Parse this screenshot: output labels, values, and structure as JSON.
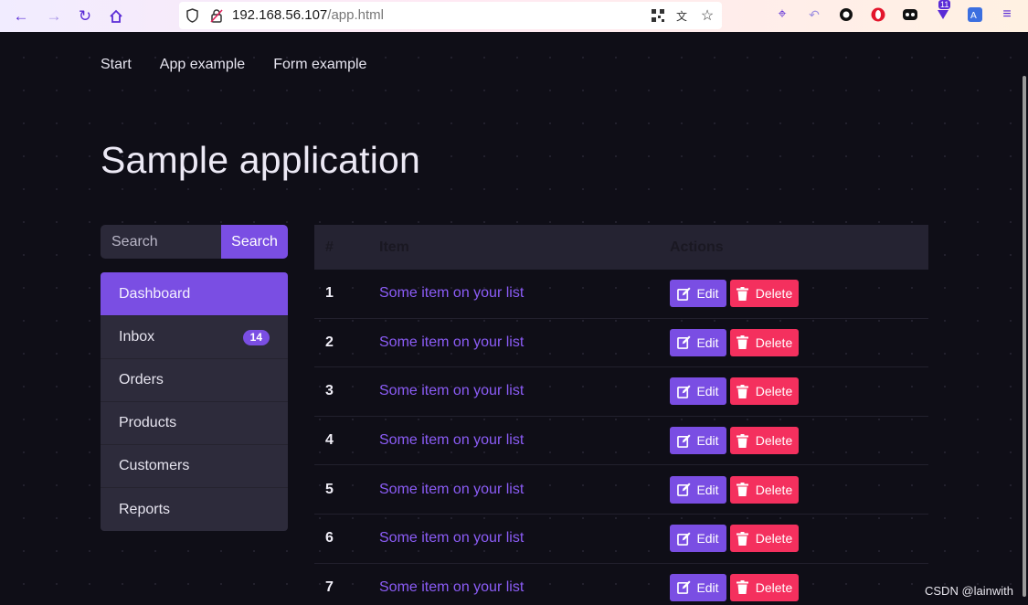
{
  "browser": {
    "url_host": "192.168.56.107",
    "url_path": "/app.html",
    "extension_badge": "11"
  },
  "nav": {
    "links": [
      "Start",
      "App example",
      "Form example"
    ]
  },
  "page_title": "Sample application",
  "search": {
    "placeholder": "Search",
    "button_label": "Search"
  },
  "sidebar": {
    "items": [
      {
        "label": "Dashboard",
        "active": true
      },
      {
        "label": "Inbox",
        "badge": "14"
      },
      {
        "label": "Orders"
      },
      {
        "label": "Products"
      },
      {
        "label": "Customers"
      },
      {
        "label": "Reports"
      }
    ]
  },
  "table": {
    "headers": {
      "num": "#",
      "item": "Item",
      "actions": "Actions"
    },
    "edit_label": "Edit",
    "delete_label": "Delete",
    "rows": [
      {
        "num": "1",
        "item": "Some item on your list"
      },
      {
        "num": "2",
        "item": "Some item on your list"
      },
      {
        "num": "3",
        "item": "Some item on your list"
      },
      {
        "num": "4",
        "item": "Some item on your list"
      },
      {
        "num": "5",
        "item": "Some item on your list"
      },
      {
        "num": "6",
        "item": "Some item on your list"
      },
      {
        "num": "7",
        "item": "Some item on your list"
      }
    ]
  },
  "colors": {
    "accent": "#7a4ee3",
    "danger": "#f4305e",
    "background": "#0f0e17",
    "surface": "#2d2b3b"
  },
  "watermark": "CSDN @lainwith"
}
